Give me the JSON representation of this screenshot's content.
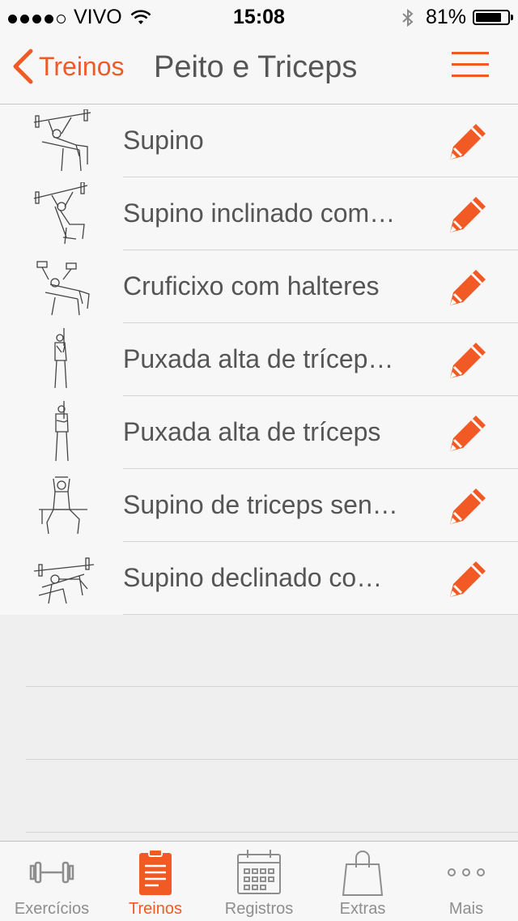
{
  "status_bar": {
    "carrier": "VIVO",
    "time": "15:08",
    "battery": "81%",
    "battery_level": 0.81,
    "signal_bars_filled": 4,
    "signal_bars_total": 5
  },
  "nav": {
    "back_label": "Treinos",
    "title": "Peito e Triceps"
  },
  "exercises": [
    {
      "name": "Supino",
      "icon": "bench-press-figure"
    },
    {
      "name": "Supino inclinado com…",
      "icon": "incline-bench-press-figure"
    },
    {
      "name": "Cruficixo com halteres",
      "icon": "dumbbell-fly-figure"
    },
    {
      "name": "Puxada alta de trícep…",
      "icon": "triceps-pushdown-figure"
    },
    {
      "name": "Puxada alta de tríceps",
      "icon": "triceps-pushdown-figure"
    },
    {
      "name": "Supino de triceps sen…",
      "icon": "seated-triceps-press-figure"
    },
    {
      "name": "Supino declinado co…",
      "icon": "decline-bench-press-figure"
    }
  ],
  "tabs": [
    {
      "label": "Exercícios",
      "icon": "dumbbell-icon",
      "active": false
    },
    {
      "label": "Treinos",
      "icon": "clipboard-icon",
      "active": true
    },
    {
      "label": "Registros",
      "icon": "calendar-icon",
      "active": false
    },
    {
      "label": "Extras",
      "icon": "shopping-bag-icon",
      "active": false
    },
    {
      "label": "Mais",
      "icon": "more-dots-icon",
      "active": false
    }
  ],
  "colors": {
    "accent": "#f15a24",
    "inactive": "#8e8e8e",
    "background": "#efefef",
    "row_background": "#f7f7f7"
  }
}
